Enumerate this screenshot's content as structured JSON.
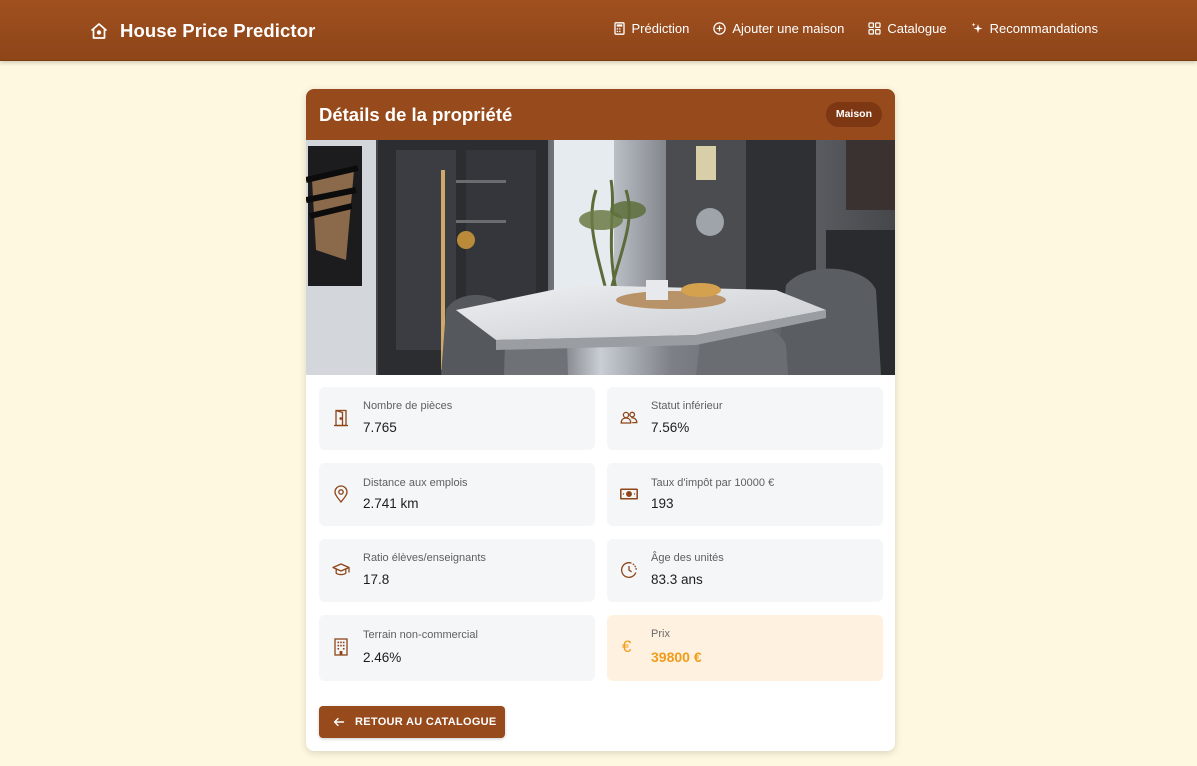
{
  "app": {
    "title": "House Price Predictor"
  },
  "nav": {
    "items": [
      {
        "label": "Prédiction",
        "icon": "calculator-icon"
      },
      {
        "label": "Ajouter une maison",
        "icon": "plus-circle-icon"
      },
      {
        "label": "Catalogue",
        "icon": "grid-icon"
      },
      {
        "label": "Recommandations",
        "icon": "sparkle-icon"
      }
    ]
  },
  "card": {
    "title": "Détails de la propriété",
    "badge": "Maison",
    "photo_alt": "dining-room-photo"
  },
  "details": [
    {
      "label": "Nombre de pièces",
      "value": "7.765",
      "icon": "door-icon"
    },
    {
      "label": "Statut inférieur",
      "value": "7.56%",
      "icon": "people-icon"
    },
    {
      "label": "Distance aux emplois",
      "value": "2.741 km",
      "icon": "location-pin-icon"
    },
    {
      "label": "Taux d'impôt par 10000 €",
      "value": "193",
      "icon": "banknote-icon"
    },
    {
      "label": "Ratio élèves/enseignants",
      "value": "17.8",
      "icon": "graduation-cap-icon"
    },
    {
      "label": "Âge des unités",
      "value": "83.3 ans",
      "icon": "clock-icon"
    },
    {
      "label": "Terrain non-commercial",
      "value": "2.46%",
      "icon": "building-icon"
    },
    {
      "label": "Prix",
      "value": "39800 €",
      "icon": "euro-icon"
    }
  ],
  "actions": {
    "back_label": "RETOUR AU CATALOGUE"
  },
  "colors": {
    "brand": "#974a1b",
    "background": "#fff8e0",
    "price_accent": "#f19c1b",
    "price_tile": "#fff1df",
    "tile": "#f5f6f8"
  }
}
